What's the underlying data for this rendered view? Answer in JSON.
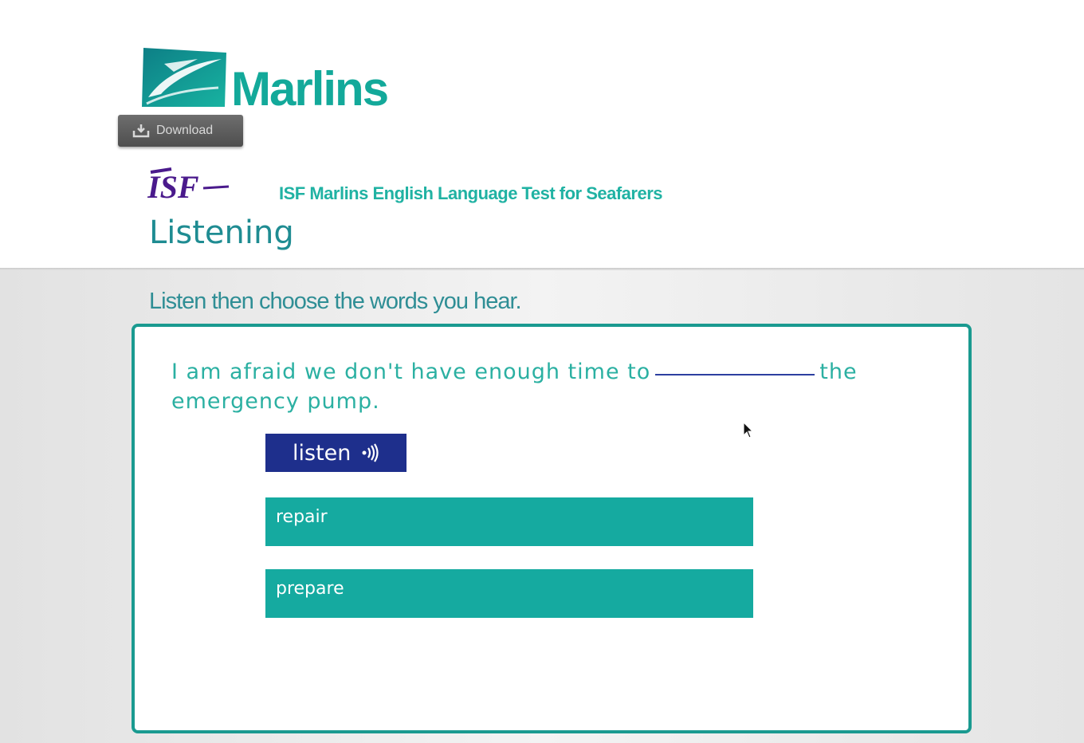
{
  "brand": {
    "logo_text": "Marlins",
    "accent_color": "#13a99a",
    "isf_logo_text": "ISF"
  },
  "toolbar": {
    "download_label": "Download"
  },
  "header": {
    "test_title": "ISF Marlins English Language Test for Seafarers",
    "section_title": "Listening"
  },
  "exercise": {
    "instruction": "Listen then choose the words you hear.",
    "sentence_before": "I am afraid we don't have enough time to",
    "sentence_after": "the emergency pump.",
    "listen_label": "listen",
    "options": [
      {
        "label": "repair"
      },
      {
        "label": "prepare"
      }
    ]
  },
  "icons": {
    "download": "download-tray-icon",
    "listen": "sound-waves-icon",
    "cursor": "mouse-pointer-icon"
  }
}
